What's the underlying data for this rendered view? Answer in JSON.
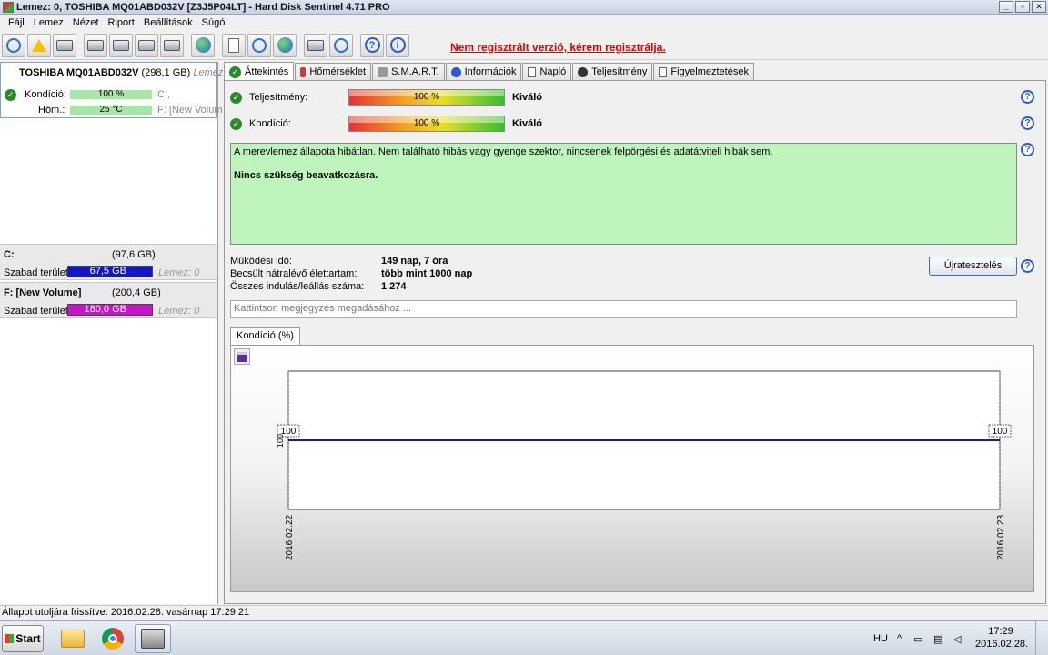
{
  "window": {
    "title": "Lemez: 0, TOSHIBA MQ01ABD032V [Z3J5P04LT]  -  Hard Disk Sentinel 4.71 PRO",
    "buttons": [
      "_",
      "▫",
      "✕"
    ]
  },
  "menu": [
    "Fájl",
    "Lemez",
    "Nézet",
    "Riport",
    "Beállítások",
    "Súgó"
  ],
  "toolbar": {
    "icons": [
      "refresh-icon",
      "warning-icon",
      "disk-icon",
      "test-icon",
      "test2-icon",
      "test3-icon",
      "test4-icon",
      "globe-icon",
      "report-icon",
      "sync-icon",
      "send-icon",
      "chart-icon",
      "speaker-icon",
      "help-icon",
      "info-icon"
    ],
    "register_text": "Nem regisztrált verzió, kérem regisztrálja."
  },
  "left": {
    "disk_name": "TOSHIBA MQ01ABD032V",
    "disk_size": "(298,1 GB)",
    "disk_extra": "Lemez",
    "health_label": "Kondíció:",
    "health_value": "100 %",
    "health_drive": "C:,",
    "temp_label": "Hőm.:",
    "temp_value": "25 °C",
    "temp_drive": "F: [New Volum",
    "volumes": [
      {
        "name": "C:",
        "size": "(97,6 GB)",
        "free_label": "Szabad terület",
        "free": "67,5 GB",
        "color": "#1414c8",
        "lemez": "Lemez: 0"
      },
      {
        "name": "F: [New Volume]",
        "size": "(200,4 GB)",
        "free_label": "Szabad terület",
        "free": "180,0 GB",
        "color": "#c814c8",
        "lemez": "Lemez: 0"
      }
    ]
  },
  "tabs": [
    "Áttekintés",
    "Hőmérséklet",
    "S.M.A.R.T.",
    "Információk",
    "Napló",
    "Teljesítmény",
    "Figyelmeztetések"
  ],
  "overview": {
    "performance_label": "Teljesítmény:",
    "performance_value": "100 %",
    "performance_text": "Kiváló",
    "performance_pct": 100,
    "health_label": "Kondíció:",
    "health_value": "100 %",
    "health_text": "Kiváló",
    "health_pct": 100,
    "status_line1": "A merevlemez állapota hibátlan. Nem található hibás vagy gyenge szektor, nincsenek felpörgési és adatátviteli hibák sem.",
    "status_line2": "Nincs szükség beavatkozásra.",
    "stats": [
      {
        "label": "Működési idő:",
        "value": "149 nap, 7 óra"
      },
      {
        "label": "Becsült hátralévő élettartam:",
        "value": "több mint 1000 nap"
      },
      {
        "label": "Összes indulás/leállás száma:",
        "value": "1 274"
      }
    ],
    "retest_label": "Újratesztelés",
    "note_placeholder": "Kattintson megjegyzés megadásához ...",
    "chart_tab": "Kondíció  (%)"
  },
  "chart_data": {
    "type": "line",
    "x": [
      "2016.02.22",
      "2016.02.23"
    ],
    "series": [
      {
        "values": [
          100,
          100
        ]
      }
    ],
    "data_labels": [
      "100",
      "100"
    ],
    "ylabel": "100",
    "color": "#1a1aa0"
  },
  "statusbar": "Állapot utoljára frissítve: 2016.02.28. vasárnap 17:29:21",
  "taskbar": {
    "start": "Start",
    "lang": "HU",
    "time": "17:29",
    "date": "2016.02.28."
  }
}
